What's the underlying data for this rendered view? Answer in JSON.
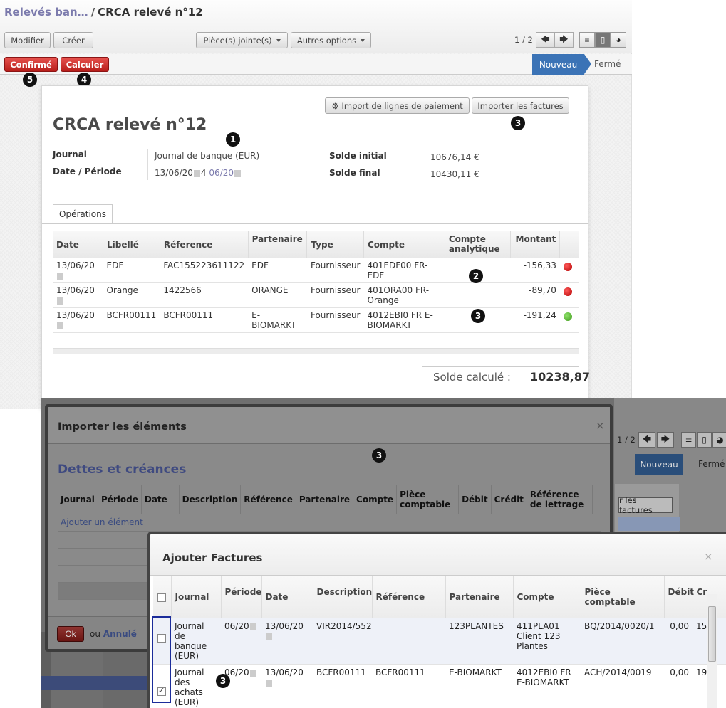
{
  "breadcrumb": {
    "parent": "Relevés ban…",
    "separator": "/",
    "current": "CRCA relevé n°12"
  },
  "toolbar": {
    "edit": "Modifier",
    "create": "Créer",
    "attachments": "Pièce(s) jointe(s)",
    "more": "Autres options",
    "pager": "1 / 2",
    "prev": "🡄",
    "next": "🡆"
  },
  "statusbar": {
    "confirm": "Confirmé",
    "compute": "Calculer",
    "stage_new": "Nouveau",
    "stage_closed": "Fermé"
  },
  "badges": {
    "one": "1",
    "two": "2",
    "three": "3",
    "four": "4",
    "five": "5"
  },
  "form": {
    "title": "CRCA relevé n°12",
    "import_lines": "Import de lignes de paiement",
    "import_invoices": "Importer les factures",
    "journal_label": "Journal",
    "journal_value": "Journal de banque (EUR)",
    "date_label": "Date / Période",
    "date_value_a": "13/06/20",
    "date_value_b": "4",
    "date_value_period": "06/20",
    "start_label": "Solde initial",
    "start_value": "10676,14 €",
    "end_label": "Solde final",
    "end_value": "10430,11 €",
    "tab_operations": "Opérations",
    "computed_label": "Solde calculé :",
    "computed_value": "10238,87"
  },
  "operations": {
    "headers": [
      "Date",
      "Libellé",
      "Réference",
      "Partenaire",
      "Type",
      "Compte",
      "Compte analytique",
      "Montant"
    ],
    "rows": [
      {
        "date": "13/06/20",
        "label": "EDF",
        "ref": "FAC155223611122",
        "partner": "EDF",
        "type": "Fournisseur",
        "account": "401EDF00 FR-EDF",
        "amount": "-156,33",
        "status": "red"
      },
      {
        "date": "13/06/20",
        "label": "Orange",
        "ref": "1422566",
        "partner": "ORANGE",
        "type": "Fournisseur",
        "account": "401ORA00 FR-Orange",
        "amount": "-89,70",
        "status": "red"
      },
      {
        "date": "13/06/20",
        "label": "BCFR00111",
        "ref": "BCFR00111",
        "partner": "E-BIOMARKT",
        "type": "Fournisseur",
        "account": "4012EBI0 FR E-BIOMARKT",
        "amount": "-191,24",
        "status": "green"
      }
    ]
  },
  "colors": {
    "accent_red": "#c9302c",
    "stage_blue": "#3b73b6",
    "link_purple": "#7c7bad",
    "status_red": "#d40000",
    "status_green": "#5cb82e"
  },
  "import_dialog": {
    "title": "Importer les éléments",
    "subtitle": "Dettes et créances",
    "headers": [
      "Journal",
      "Période",
      "Date",
      "Description",
      "Référence",
      "Partenaire",
      "Compte",
      "Pièce comptable",
      "Débit",
      "Crédit",
      "Référence de lettrage"
    ],
    "add_item": "Ajouter un élément",
    "ok": "Ok",
    "or": "ou",
    "cancel": "Annulé",
    "close": "×"
  },
  "ghost": {
    "pager": "1 / 2",
    "stage_new": "Nouveau",
    "stage_closed": "Fermé",
    "import_btn": "r les factures"
  },
  "invoices_dialog": {
    "title": "Ajouter Factures",
    "close": "×",
    "headers": [
      "Journal",
      "Période",
      "Date",
      "Description",
      "Référence",
      "Partenaire",
      "Compte",
      "Pièce comptable",
      "Débit",
      "Cr"
    ],
    "rows": [
      {
        "journal": "Journal de banque (EUR)",
        "period": "06/20",
        "date": "13/06/20",
        "description": "VIR2014/552",
        "ref": "",
        "partner": "123PLANTES",
        "account": "411PLA01 Client 123 Plantes",
        "move": "BQ/2014/0020/1",
        "debit": "0,00",
        "credit": "15",
        "checked": false
      },
      {
        "journal": "Journal des achats (EUR)",
        "period": "06/20",
        "date": "13/06/20",
        "description": "BCFR00111",
        "ref": "BCFR00111",
        "partner": "E-BIOMARKT",
        "account": "4012EBI0 FR E-BIOMARKT",
        "move": "ACH/2014/0019",
        "debit": "0,00",
        "credit": "19",
        "checked": true
      }
    ]
  }
}
